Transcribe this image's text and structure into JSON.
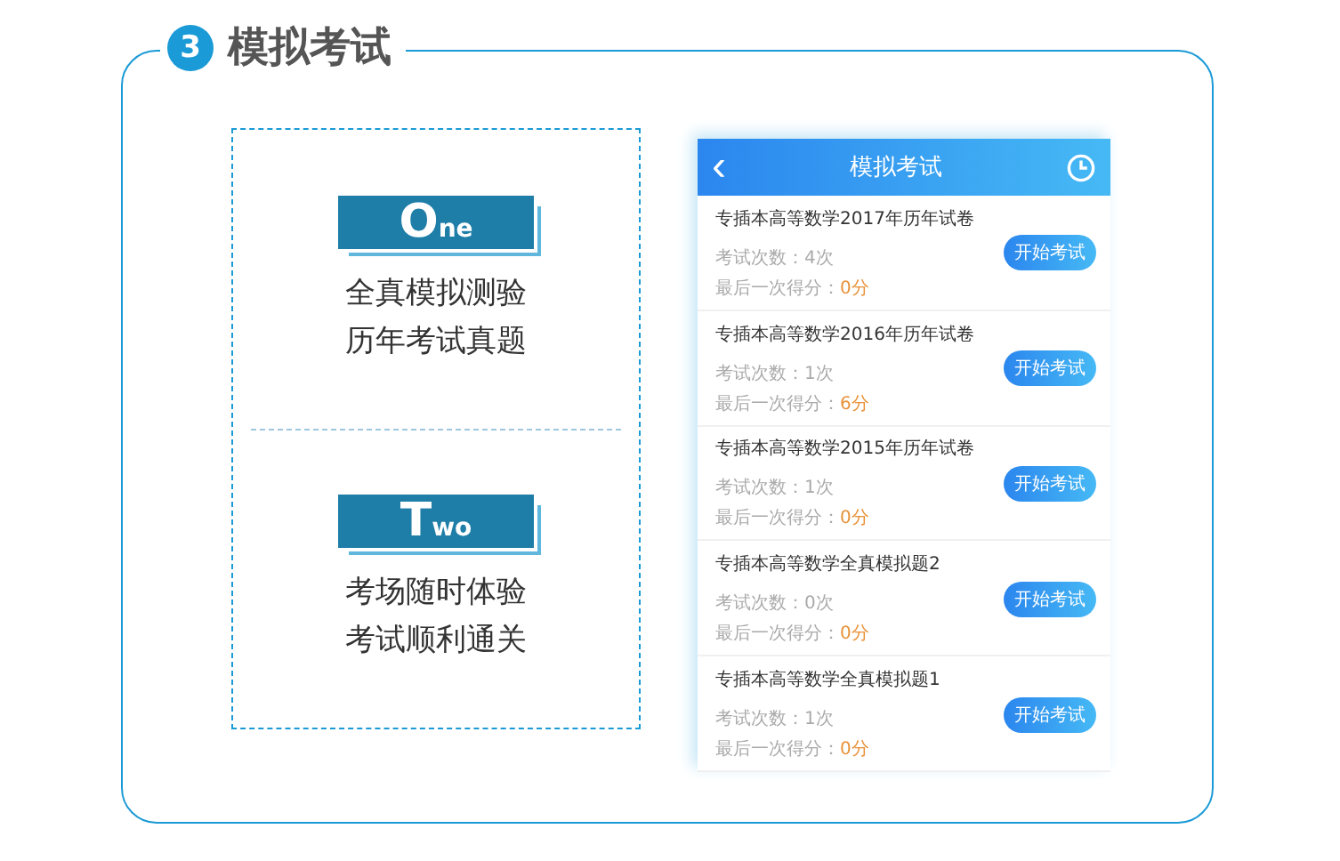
{
  "section": {
    "number": "3",
    "title": "模拟考试"
  },
  "features": [
    {
      "badge": "One",
      "lines": [
        "全真模拟测验",
        "历年考试真题"
      ]
    },
    {
      "badge": "Two",
      "lines": [
        "考场随时体验",
        "考试顺利通关"
      ]
    }
  ],
  "phone": {
    "back": "‹",
    "title": "模拟考试",
    "exams": [
      {
        "name": "专插本高等数学2017年历年试卷",
        "count_label": "考试次数：",
        "count": "4次",
        "score_label": "最后一次得分：",
        "score": "0分",
        "button": "开始考试"
      },
      {
        "name": "专插本高等数学2016年历年试卷",
        "count_label": "考试次数：",
        "count": "1次",
        "score_label": "最后一次得分：",
        "score": "6分",
        "button": "开始考试"
      },
      {
        "name": "专插本高等数学2015年历年试卷",
        "count_label": "考试次数：",
        "count": "1次",
        "score_label": "最后一次得分：",
        "score": "0分",
        "button": "开始考试"
      },
      {
        "name": "专插本高等数学全真模拟题2",
        "count_label": "考试次数：",
        "count": "0次",
        "score_label": "最后一次得分：",
        "score": "0分",
        "button": "开始考试"
      },
      {
        "name": "专插本高等数学全真模拟题1",
        "count_label": "考试次数：",
        "count": "1次",
        "score_label": "最后一次得分：",
        "score": "0分",
        "button": "开始考试"
      }
    ]
  }
}
